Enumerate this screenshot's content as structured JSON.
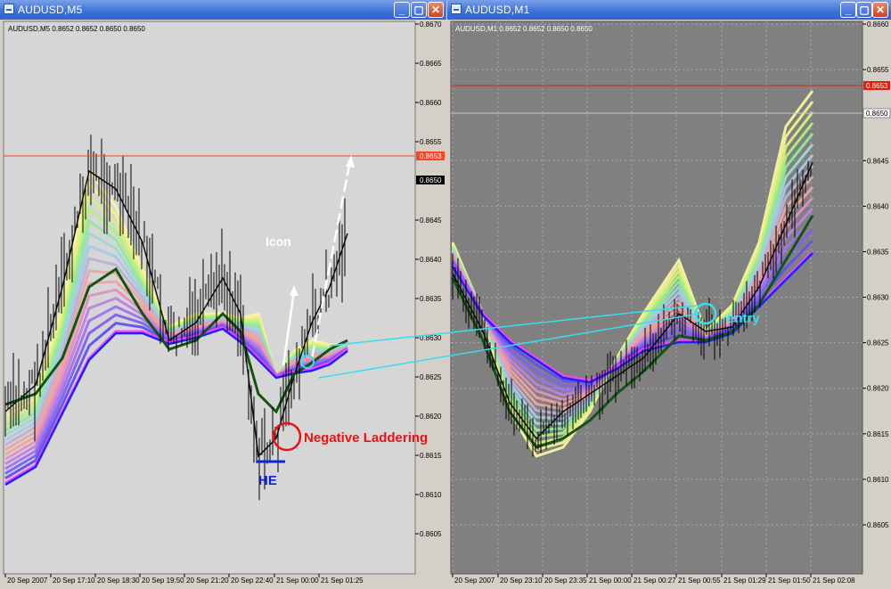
{
  "left_window": {
    "title": "AUDUSD,M5",
    "info": "AUDUSD,M5  0.8652 0.8652 0.8650 0.8650",
    "price_labels": [
      "0.8670",
      "0.8665",
      "0.8660",
      "0.8655",
      "0.8645",
      "0.8640",
      "0.8635",
      "0.8630",
      "0.8625",
      "0.8620",
      "0.8615",
      "0.8610",
      "0.8605"
    ],
    "bid_label": "0.8653",
    "ask_label": "0.8650",
    "time_labels": [
      "20 Sep 2007",
      "20 Sep 17:10",
      "20 Sep 18:30",
      "20 Sep 19:50",
      "20 Sep 21:20",
      "20 Sep 22:40",
      "21 Sep 00:00",
      "21 Sep 01:25"
    ],
    "annotation_icon": "Icon",
    "annotation_negative": "Negative  Laddering",
    "annotation_he": "HE"
  },
  "right_window": {
    "title": "AUDUSD,M1",
    "info": "AUDUSD,M1  0.8652 0.8652 0.8650 0.8650",
    "price_labels": [
      "0.8660",
      "0.8655",
      "0.8645",
      "0.8640",
      "0.8635",
      "0.8630",
      "0.8625",
      "0.8620",
      "0.8615",
      "0.8610",
      "0.8605"
    ],
    "bid_label": "0.8653",
    "ask_label": "0.8650",
    "time_labels": [
      "20 Sep 2007",
      "20 Sep 23:10",
      "20 Sep 23:35",
      "21 Sep 00:00",
      "21 Sep 00:27",
      "21 Sep 00:55",
      "21 Sep 01:29",
      "21 Sep 01:50",
      "21 Sep 02:08"
    ],
    "annotation_entry": "entry"
  },
  "colors": {
    "left_bg": "#d6d6d6",
    "right_bg": "#808080",
    "bid_line": "#ff4422",
    "entry_circle": "#33e0f0",
    "negative_circle": "#ee1111",
    "he_mark": "#1122dd"
  },
  "icons": [
    "window-minimize-icon",
    "window-maximize-icon",
    "window-close-icon"
  ]
}
